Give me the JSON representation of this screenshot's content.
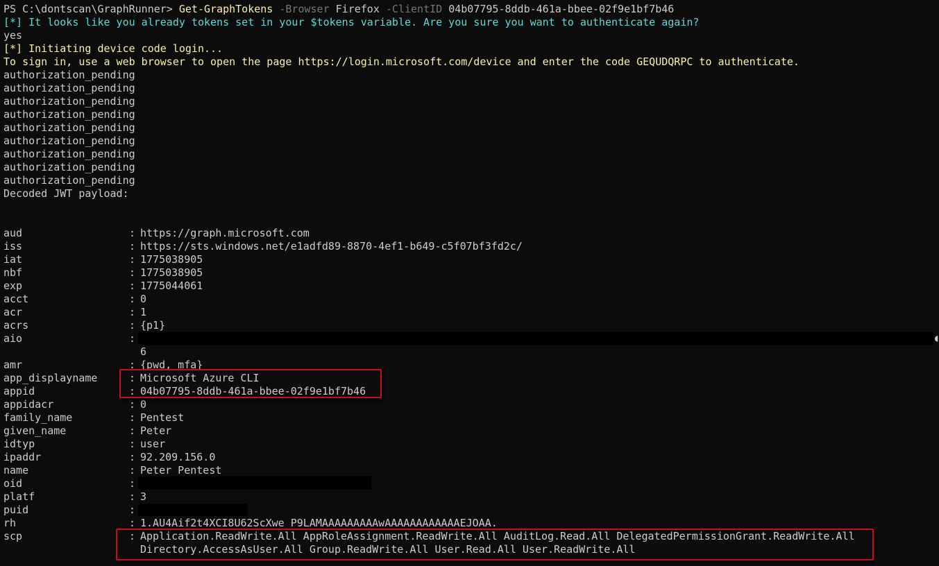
{
  "prompt": {
    "ps": "PS C:\\dontscan\\GraphRunner> ",
    "cmd": "Get-GraphTokens",
    "p1": " -Browser",
    "v1": " Firefox",
    "p2": " -ClientID",
    "v2": " 04b07795-8ddb-461a-bbee-02f9e1bf7b46"
  },
  "messages": {
    "already": "[*] It looks like you already tokens set in your $tokens variable. Are you sure you want to authenticate again?",
    "yes": "yes",
    "initiating": "[*] Initiating device code login...",
    "signin": "To sign in, use a web browser to open the page https://login.microsoft.com/device and enter the code GEQUDQRPC to authenticate.",
    "pending": [
      "authorization_pending",
      "authorization_pending",
      "authorization_pending",
      "authorization_pending",
      "authorization_pending",
      "authorization_pending",
      "authorization_pending",
      "authorization_pending",
      "authorization_pending"
    ],
    "decoded": "Decoded JWT payload:"
  },
  "separator": ": ",
  "jwt": {
    "aud": {
      "key": "aud",
      "value": "https://graph.microsoft.com"
    },
    "iss": {
      "key": "iss",
      "value": "https://sts.windows.net/e1adfd89-8870-4ef1-b649-c5f07bf3fd2c/"
    },
    "iat": {
      "key": "iat",
      "value": "1775038905"
    },
    "nbf": {
      "key": "nbf",
      "value": "1775038905"
    },
    "exp": {
      "key": "exp",
      "value": "1775044061"
    },
    "acct": {
      "key": "acct",
      "value": "0"
    },
    "acr": {
      "key": "acr",
      "value": "1"
    },
    "acrs": {
      "key": "acrs",
      "value": "{p1}"
    },
    "aio": {
      "key": "aio",
      "value": "",
      "wrap": "6"
    },
    "amr": {
      "key": "amr",
      "value": "{pwd, mfa}"
    },
    "app_displayname": {
      "key": "app_displayname",
      "value": "Microsoft Azure CLI"
    },
    "appid": {
      "key": "appid",
      "value": "04b07795-8ddb-461a-bbee-02f9e1bf7b46"
    },
    "appidacr": {
      "key": "appidacr",
      "value": "0"
    },
    "family_name": {
      "key": "family_name",
      "value": "Pentest"
    },
    "given_name": {
      "key": "given_name",
      "value": "Peter"
    },
    "idtyp": {
      "key": "idtyp",
      "value": "user"
    },
    "ipaddr": {
      "key": "ipaddr",
      "value": "92.209.156.0"
    },
    "name": {
      "key": "name",
      "value": "Peter Pentest"
    },
    "oid": {
      "key": "oid",
      "value": ""
    },
    "platf": {
      "key": "platf",
      "value": "3"
    },
    "puid": {
      "key": "puid",
      "value": ""
    },
    "rh": {
      "key": "rh",
      "value": "1.AU4Aif2t4XCI8U62ScXwe_P9LAMAAAAAAAAAwAAAAAAAAAAAAEJOAA."
    },
    "scp": {
      "key": "scp",
      "value": "Application.ReadWrite.All AppRoleAssignment.ReadWrite.All AuditLog.Read.All DelegatedPermissionGrant.ReadWrite.All",
      "wrap": "Directory.AccessAsUser.All Group.ReadWrite.All User.Read.All User.ReadWrite.All"
    }
  },
  "colors": {
    "background": "#0c0c0c",
    "text": "#cccccc",
    "command": "#f9f1a5",
    "info": "#61d6d6",
    "param": "#767676",
    "highlight": "#c50f1f"
  }
}
